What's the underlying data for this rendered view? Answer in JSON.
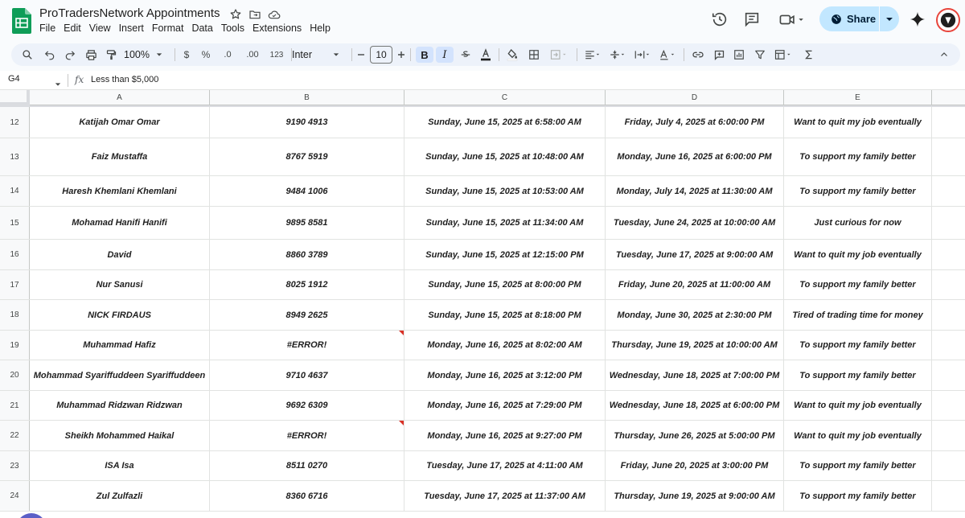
{
  "header": {
    "title": "ProTradersNetwork Appointments",
    "menu": [
      "File",
      "Edit",
      "View",
      "Insert",
      "Format",
      "Data",
      "Tools",
      "Extensions",
      "Help"
    ],
    "share_label": "Share"
  },
  "toolbar": {
    "zoom": "100%",
    "currency": "$",
    "percent": "%",
    "dec_less": ".0",
    "dec_more": ".00",
    "number_format": "123",
    "font": "Inter",
    "font_size": "10",
    "bold": "B",
    "italic": "I"
  },
  "formula_bar": {
    "cell_ref": "G4",
    "fx": "fx",
    "value": "Less than $5,000"
  },
  "columns": [
    "A",
    "B",
    "C",
    "D",
    "E"
  ],
  "rows": [
    {
      "num": "12",
      "name": "Katijah Omar Omar",
      "phone": "9190 4913",
      "submitted": "Sunday, June 15, 2025 at 6:58:00 AM",
      "appointment": "Friday, July 4, 2025 at 6:00:00 PM",
      "reason": "Want to quit my job eventually",
      "error": false
    },
    {
      "num": "13",
      "name": "Faiz Mustaffa",
      "phone": "8767 5919",
      "submitted": "Sunday, June 15, 2025 at 10:48:00 AM",
      "appointment": "Monday, June 16, 2025 at 6:00:00 PM",
      "reason": "To support my family better",
      "error": false
    },
    {
      "num": "14",
      "name": "Haresh Khemlani Khemlani",
      "phone": "9484 1006",
      "submitted": "Sunday, June 15, 2025 at 10:53:00 AM",
      "appointment": "Monday, July 14, 2025 at 11:30:00 AM",
      "reason": "To support my family better",
      "error": false
    },
    {
      "num": "15",
      "name": "Mohamad Hanifi Hanifi",
      "phone": "9895 8581",
      "submitted": "Sunday, June 15, 2025 at 11:34:00 AM",
      "appointment": "Tuesday, June 24, 2025 at 10:00:00 AM",
      "reason": "Just curious for now",
      "error": false
    },
    {
      "num": "16",
      "name": "David",
      "phone": "8860 3789",
      "submitted": "Sunday, June 15, 2025 at 12:15:00 PM",
      "appointment": "Tuesday, June 17, 2025 at 9:00:00 AM",
      "reason": "Want to quit my job eventually",
      "error": false
    },
    {
      "num": "17",
      "name": "Nur Sanusi",
      "phone": "8025 1912",
      "submitted": "Sunday, June 15, 2025 at 8:00:00 PM",
      "appointment": "Friday, June 20, 2025 at 11:00:00 AM",
      "reason": "To support my family better",
      "error": false
    },
    {
      "num": "18",
      "name": "NICK FIRDAUS",
      "phone": "8949 2625",
      "submitted": "Sunday, June 15, 2025 at 8:18:00 PM",
      "appointment": "Monday, June 30, 2025 at 2:30:00 PM",
      "reason": "Tired of trading time for money",
      "error": false
    },
    {
      "num": "19",
      "name": "Muhammad Hafiz",
      "phone": "#ERROR!",
      "submitted": "Monday, June 16, 2025 at 8:02:00 AM",
      "appointment": "Thursday, June 19, 2025 at 10:00:00 AM",
      "reason": "To support my family better",
      "error": true
    },
    {
      "num": "20",
      "name": "Mohammad Syariffuddeen Syariffuddeen",
      "phone": "9710 4637",
      "submitted": "Monday, June 16, 2025 at 3:12:00 PM",
      "appointment": "Wednesday, June 18, 2025 at 7:00:00 PM",
      "reason": "To support my family better",
      "error": false
    },
    {
      "num": "21",
      "name": "Muhammad Ridzwan Ridzwan",
      "phone": "9692 6309",
      "submitted": "Monday, June 16, 2025 at 7:29:00 PM",
      "appointment": "Wednesday, June 18, 2025 at 6:00:00 PM",
      "reason": "Want to quit my job eventually",
      "error": false
    },
    {
      "num": "22",
      "name": "Sheikh Mohammed Haikal",
      "phone": "#ERROR!",
      "submitted": "Monday, June 16, 2025 at 9:27:00 PM",
      "appointment": "Thursday, June 26, 2025 at 5:00:00 PM",
      "reason": "Want to quit my job eventually",
      "error": true
    },
    {
      "num": "23",
      "name": "ISA Isa",
      "phone": "8511 0270",
      "submitted": "Tuesday, June 17, 2025 at 4:11:00 AM",
      "appointment": "Friday, June 20, 2025 at 3:00:00 PM",
      "reason": "To support my family better",
      "error": false
    },
    {
      "num": "24",
      "name": "Zul Zulfazli",
      "phone": "8360 6716",
      "submitted": "Tuesday, June 17, 2025 at 11:37:00 AM",
      "appointment": "Thursday, June 19, 2025 at 9:00:00 AM",
      "reason": "To support my family better",
      "error": false
    }
  ],
  "colors": {
    "sheets_green": "#0f9d58",
    "share_bg": "#c2e7ff",
    "error_flag": "#d93025"
  }
}
